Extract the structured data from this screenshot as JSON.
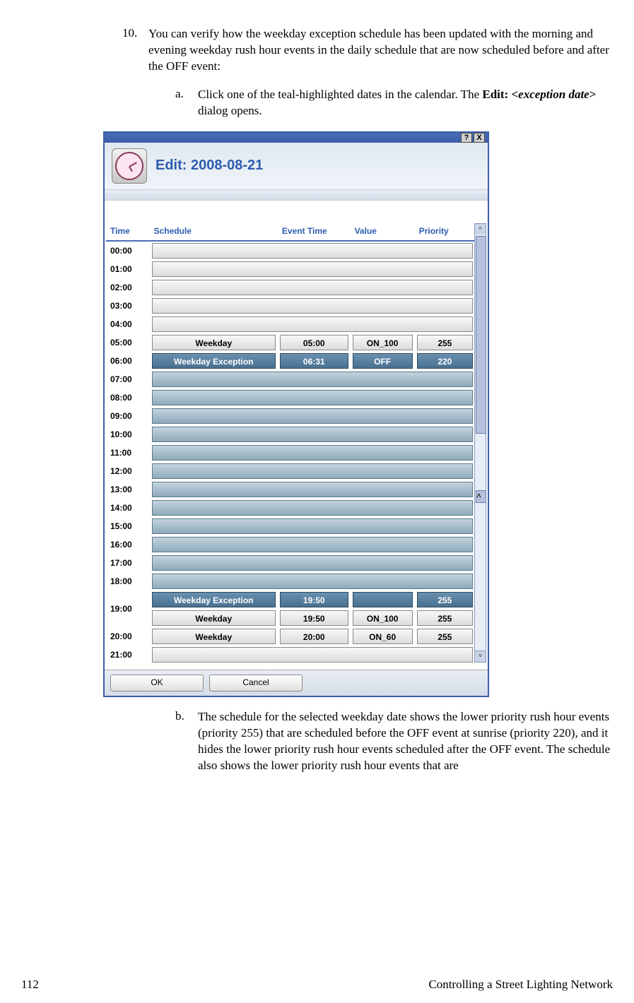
{
  "item10": {
    "number": "10.",
    "text": "You can verify how the weekday exception schedule has been updated with the morning and evening weekday rush hour events in the daily schedule that are now scheduled before and after the OFF event:",
    "a": {
      "letter": "a.",
      "pre": "Click one of the teal-highlighted dates in the calendar.  The ",
      "bold": "Edit: ",
      "italic": "<exception date>",
      "post": " dialog opens."
    },
    "b": {
      "letter": "b.",
      "text": "The schedule for the selected weekday date shows the lower priority rush hour events (priority 255) that are scheduled before the OFF event at sunrise (priority 220), and it hides the lower priority rush hour events scheduled after the OFF event.  The schedule also shows the lower priority rush hour events that are"
    }
  },
  "dialog": {
    "title": "Edit: 2008-08-21",
    "help": "?",
    "close": "X",
    "headers": {
      "time": "Time",
      "schedule": "Schedule",
      "event": "Event Time",
      "value": "Value",
      "priority": "Priority"
    },
    "rows": [
      {
        "time": "00:00",
        "teal": false,
        "subrows": [
          {}
        ]
      },
      {
        "time": "01:00",
        "teal": false,
        "subrows": [
          {}
        ]
      },
      {
        "time": "02:00",
        "teal": false,
        "subrows": [
          {}
        ]
      },
      {
        "time": "03:00",
        "teal": false,
        "subrows": [
          {}
        ]
      },
      {
        "time": "04:00",
        "teal": false,
        "subrows": [
          {}
        ]
      },
      {
        "time": "05:00",
        "teal": false,
        "subrows": [
          {
            "schedule": "Weekday",
            "event": "05:00",
            "value": "ON_100",
            "priority": "255"
          }
        ]
      },
      {
        "time": "06:00",
        "teal": false,
        "sel": true,
        "subrows": [
          {
            "schedule": "Weekday Exception",
            "event": "06:31",
            "value": "OFF",
            "priority": "220"
          }
        ]
      },
      {
        "time": "07:00",
        "teal": true,
        "subrows": [
          {}
        ]
      },
      {
        "time": "08:00",
        "teal": true,
        "subrows": [
          {}
        ]
      },
      {
        "time": "09:00",
        "teal": true,
        "subrows": [
          {}
        ]
      },
      {
        "time": "10:00",
        "teal": true,
        "subrows": [
          {}
        ]
      },
      {
        "time": "11:00",
        "teal": true,
        "subrows": [
          {}
        ]
      },
      {
        "time": "12:00",
        "teal": true,
        "subrows": [
          {}
        ]
      },
      {
        "time": "13:00",
        "teal": true,
        "subrows": [
          {}
        ]
      },
      {
        "time": "14:00",
        "teal": true,
        "subrows": [
          {}
        ]
      },
      {
        "time": "15:00",
        "teal": true,
        "subrows": [
          {}
        ]
      },
      {
        "time": "16:00",
        "teal": true,
        "subrows": [
          {}
        ]
      },
      {
        "time": "17:00",
        "teal": true,
        "subrows": [
          {}
        ]
      },
      {
        "time": "18:00",
        "teal": true,
        "subrows": [
          {}
        ]
      },
      {
        "time": "19:00",
        "teal": false,
        "subrows": [
          {
            "schedule": "Weekday Exception",
            "event": "19:50",
            "value": "",
            "priority": "255",
            "sel": true
          },
          {
            "schedule": "Weekday",
            "event": "19:50",
            "value": "ON_100",
            "priority": "255"
          }
        ]
      },
      {
        "time": "20:00",
        "teal": false,
        "subrows": [
          {
            "schedule": "Weekday",
            "event": "20:00",
            "value": "ON_60",
            "priority": "255"
          }
        ]
      },
      {
        "time": "21:00",
        "teal": false,
        "subrows": [
          {}
        ]
      }
    ],
    "ok": "OK",
    "cancel": "Cancel"
  },
  "footer": {
    "page": "112",
    "title": "Controlling a Street Lighting Network"
  }
}
